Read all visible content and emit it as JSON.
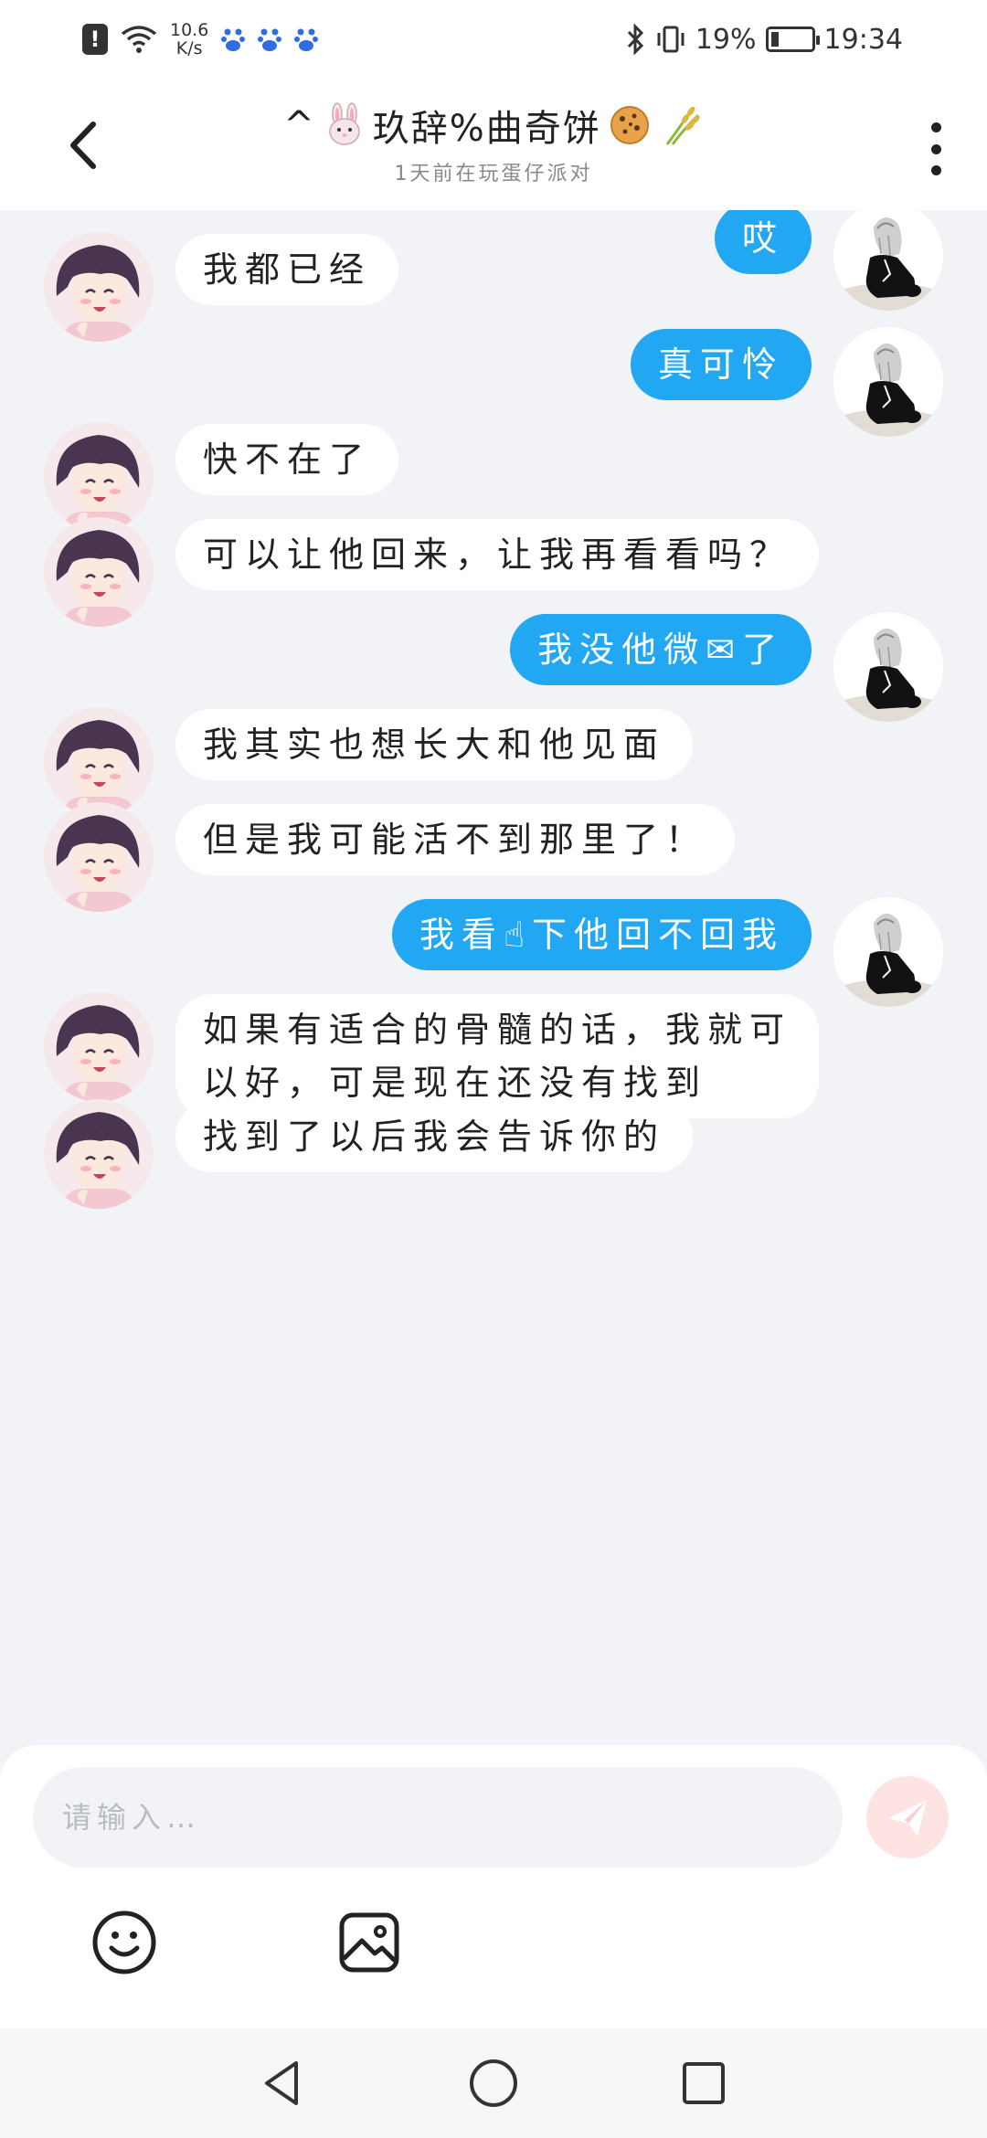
{
  "status_bar": {
    "net_speed_value": "10.6",
    "net_speed_unit": "K/s",
    "battery_percent_label": "19%",
    "battery_level": 0.19,
    "time": "19:34",
    "icons": [
      "alert-icon",
      "wifi-icon",
      "paw-icon",
      "paw-icon",
      "paw-icon",
      "bluetooth-icon",
      "vibrate-icon",
      "battery-icon"
    ]
  },
  "header": {
    "title_prefix": "^",
    "title_text": "玖辞%曲奇饼",
    "title_emojis": [
      "rabbit-face",
      "cookie",
      "sheaf-of-rice"
    ],
    "subtitle": "1天前在玩蛋仔派对"
  },
  "messages": [
    {
      "side": "out",
      "text": "哎"
    },
    {
      "side": "in",
      "text": "我都已经"
    },
    {
      "side": "out",
      "text": "真可怜"
    },
    {
      "side": "in",
      "text": "快不在了"
    },
    {
      "side": "in",
      "text": "可以让他回来，让我再看看吗？"
    },
    {
      "side": "out",
      "text": "我没他微✉了"
    },
    {
      "side": "in",
      "text": "我其实也想长大和他见面"
    },
    {
      "side": "in",
      "text": "但是我可能活不到那里了！"
    },
    {
      "side": "out",
      "text": "我看☝下他回不回我"
    },
    {
      "side": "in",
      "text": "如果有适合的骨髓的话，我就可\n以好，可是现在还没有找到"
    },
    {
      "side": "in",
      "text": "找到了以后我会告诉你的"
    }
  ],
  "composer": {
    "placeholder": "请输入…",
    "value": "",
    "send_color": "#fde3e2"
  },
  "colors": {
    "outgoing_bubble": "#22a7f2",
    "incoming_bubble": "#ffffff",
    "chat_background": "#f1f3f6"
  },
  "navbar": {
    "icons": [
      "back-triangle-icon",
      "home-circle-icon",
      "recents-square-icon"
    ]
  }
}
